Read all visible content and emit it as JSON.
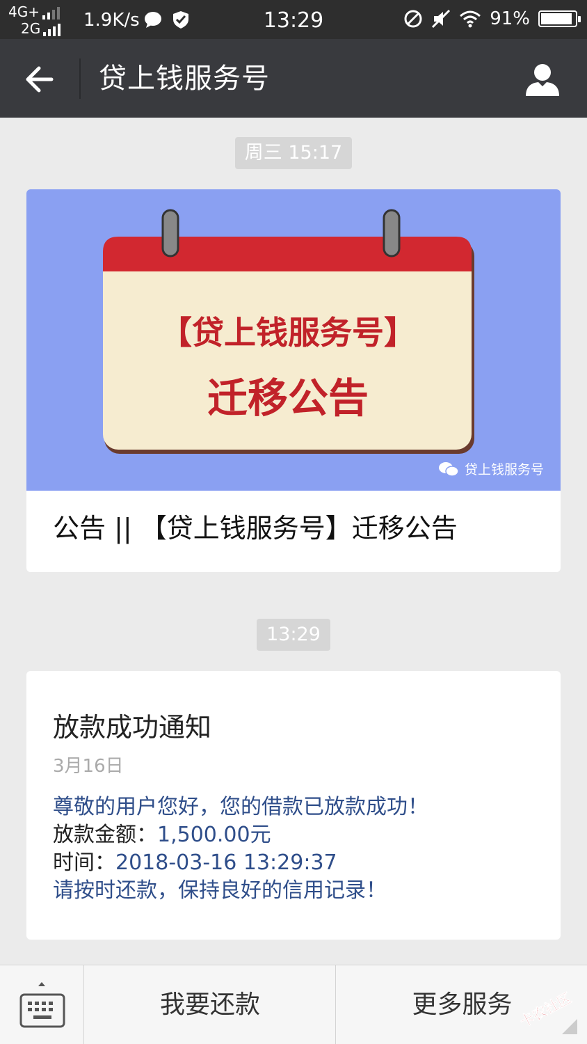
{
  "status_bar": {
    "net_top": "4G+",
    "net_bottom": "2G",
    "speed": "1.9K/s",
    "time": "13:29",
    "battery": "91%",
    "battery_level": 0.91
  },
  "nav": {
    "title": "贷上钱服务号"
  },
  "messages": {
    "ts1": "周三 15:17",
    "ts2": "13:29"
  },
  "article": {
    "banner_line1": "【贷上钱服务号】",
    "banner_line2": "迁移公告",
    "watermark": "贷上钱服务号",
    "title": "公告 || 【贷上钱服务号】迁移公告"
  },
  "notice": {
    "title": "放款成功通知",
    "date": "3月16日",
    "greeting": "尊敬的用户您好，您的借款已放款成功！",
    "amount_label": "放款金额：",
    "amount_value": "1,500.00元",
    "time_label": "时间：",
    "time_value": "2018-03-16 13:29:37",
    "reminder": "请按时还款，保持良好的信用记录！"
  },
  "menu": {
    "item1": "我要还款",
    "item2": "更多服务"
  },
  "forum_stamp": "卡农社区",
  "colors": {
    "nav_bg": "#393a3e",
    "status_bg": "#2e2e2e",
    "cover_bg": "#8aa0f2",
    "calendar_red": "#d22830",
    "calendar_paper": "#f6ecd0",
    "notice_blue": "#2f4e8a"
  }
}
